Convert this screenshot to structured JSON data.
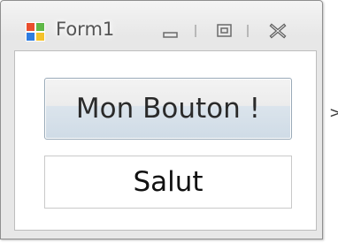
{
  "window": {
    "title": "Form1",
    "icons": {
      "app": "windows-form-icon",
      "minimize": "minimize-icon",
      "maximize": "maximize-icon",
      "close": "close-icon"
    }
  },
  "form": {
    "button_label": "Mon Bouton !",
    "label_text": "Salut"
  },
  "outside": {
    "edge_glyph": ">"
  },
  "colors": {
    "window_frame": "#8f8f8f",
    "client_background": "#ffffff",
    "button_gradient_top": "#f3f3f3",
    "button_gradient_bottom": "#cfdbe6",
    "button_border": "#9aaab8"
  }
}
